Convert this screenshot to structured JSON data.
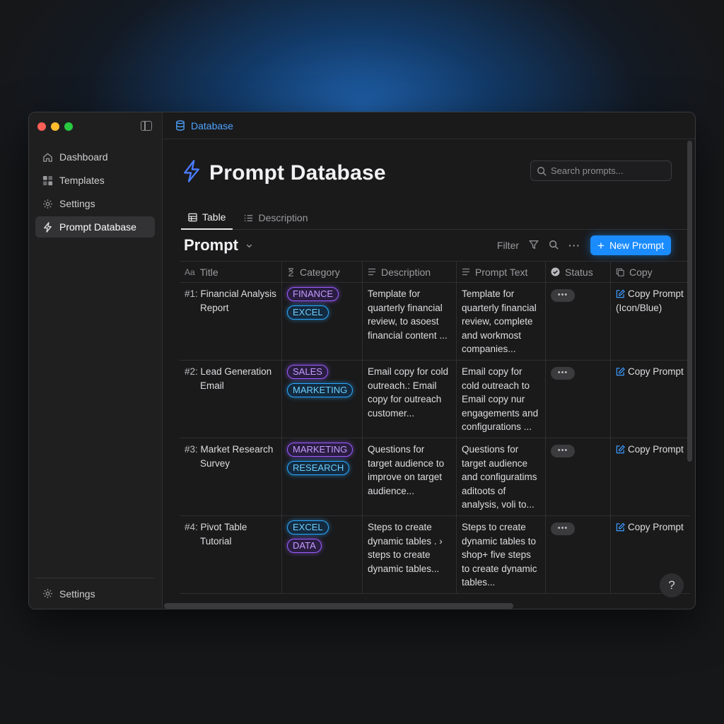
{
  "sidebar": {
    "items": [
      {
        "label": "Dashboard",
        "icon": "home-icon"
      },
      {
        "label": "Templates",
        "icon": "grid-icon"
      },
      {
        "label": "Settings",
        "icon": "gear-icon"
      },
      {
        "label": "Prompt Database",
        "icon": "bolt-icon",
        "active": true
      }
    ],
    "bottom_label": "Settings"
  },
  "breadcrumb": {
    "label": "Database"
  },
  "page": {
    "title": "Prompt Database"
  },
  "search": {
    "placeholder": "Search prompts..."
  },
  "tabs": [
    {
      "label": "Table",
      "active": true
    },
    {
      "label": "Description",
      "active": false
    }
  ],
  "view": {
    "title": "Prompt",
    "filter_label": "Filter",
    "new_button": "New Prompt"
  },
  "table": {
    "headers": [
      "Title",
      "Category",
      "Description",
      "Prompt Text",
      "Status",
      "Copy"
    ],
    "header_icons": [
      "Aa",
      "hourglass-icon",
      "lines-icon",
      "lines-icon",
      "check-circle-icon",
      "copy-icon"
    ],
    "rows": [
      {
        "num": "#1:",
        "title": "Financial Analysis Report",
        "tags": [
          {
            "label": "FINANCE",
            "color": "purple"
          },
          {
            "label": "EXCEL",
            "color": "blue"
          }
        ],
        "description": "Template for quarterly financial review, to asoest financial content ...",
        "prompt_text": "Template for quarterly financial review, complete and workmost companies...",
        "status": "•••",
        "copy": "Copy Prompt (Icon/Blue)"
      },
      {
        "num": "#2:",
        "title": "Lead Generation Email",
        "tags": [
          {
            "label": "SALES",
            "color": "purple"
          },
          {
            "label": "MARKETING",
            "color": "blue"
          }
        ],
        "description": "Email copy for cold outreach.: Email copy for outreach customer...",
        "prompt_text": "Email copy for cold outreach to Email copy nur engagements and configurations ...",
        "status": "•••",
        "copy": "Copy Prompt"
      },
      {
        "num": "#3:",
        "title": "Market Research Survey",
        "tags": [
          {
            "label": "MARKETING",
            "color": "purple"
          },
          {
            "label": "RESEARCH",
            "color": "blue"
          }
        ],
        "description": "Questions for target audience to improve on target audience...",
        "prompt_text": "Questions for target audience and configuratims aditoots of analysis, voli to...",
        "status": "•••",
        "copy": "Copy Prompt"
      },
      {
        "num": "#4:",
        "title": "Pivot Table Tutorial",
        "tags": [
          {
            "label": "EXCEL",
            "color": "blue"
          },
          {
            "label": "DATA",
            "color": "purple"
          }
        ],
        "description": "Steps to create dynamic tables . › steps to create dynamic tables...",
        "prompt_text": "Steps to create dynamic tables to shop+ five steps to create dynamic tables...",
        "status": "•••",
        "copy": "Copy Prompt"
      }
    ]
  },
  "help": {
    "label": "?"
  },
  "colors": {
    "accent": "#1a8cff",
    "link": "#3d9bff",
    "tag_purple": "#9b5cff",
    "tag_blue": "#2aa8ff"
  }
}
